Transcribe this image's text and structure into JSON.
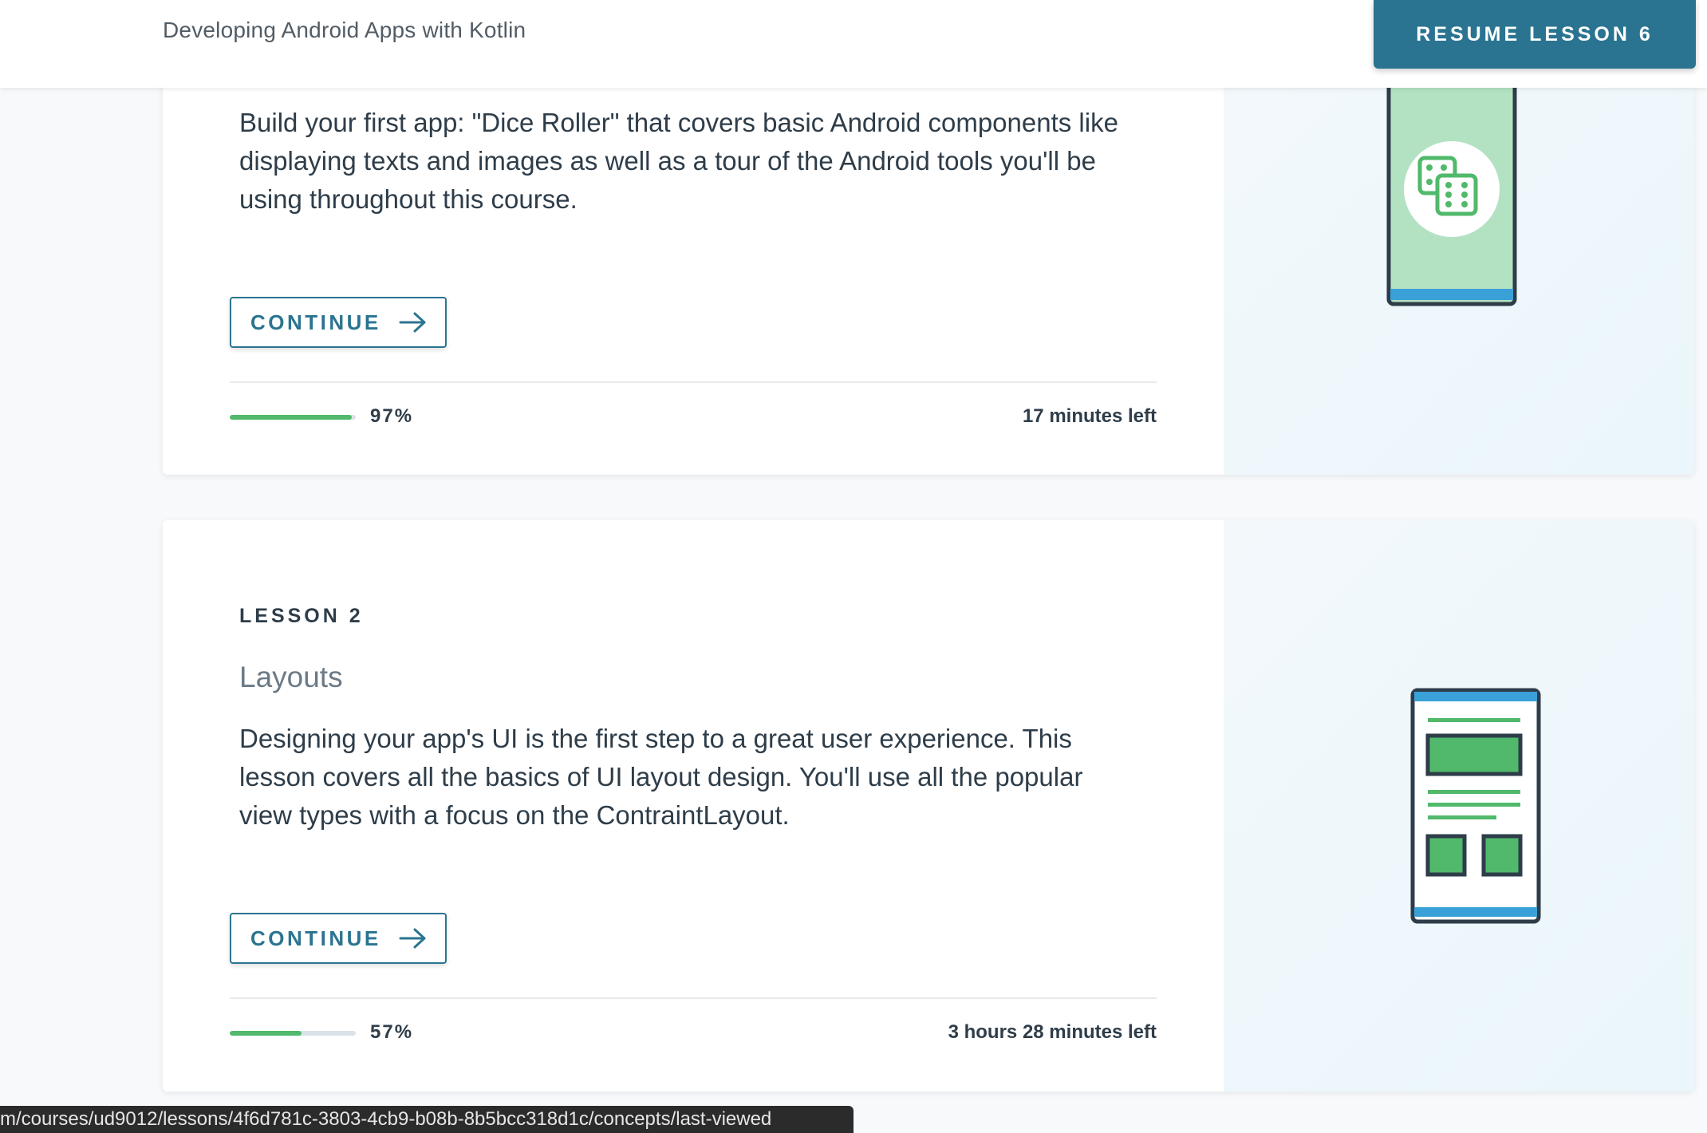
{
  "header": {
    "course_title": "Developing Android Apps with Kotlin",
    "resume_label": "RESUME LESSON 6"
  },
  "lessons": [
    {
      "label": "",
      "name": "",
      "description": "Build your first app: \"Dice Roller\" that covers basic Android components like displaying texts and images as well as a tour of the Android tools you'll be using throughout this course.",
      "continue_label": "CONTINUE",
      "progress_percent": 97,
      "progress_text": "97%",
      "time_left": "17 minutes left",
      "illustration": "dice-phone-icon"
    },
    {
      "label": "LESSON 2",
      "name": "Layouts",
      "description": "Designing your app's UI is the first step to a great user experience. This lesson covers all the basics of UI layout design. You'll use all the popular view types with a focus on the ContraintLayout.",
      "continue_label": "CONTINUE",
      "progress_percent": 57,
      "progress_text": "57%",
      "time_left": "3 hours 28 minutes left",
      "illustration": "layout-phone-icon"
    }
  ],
  "status_bar": {
    "url": "m/courses/ud9012/lessons/4f6d781c-3803-4cb9-b08b-8b5bcc318d1c/concepts/last-viewed"
  },
  "colors": {
    "accent": "#2a7491",
    "progress": "#51b96b",
    "text": "#2e3d49"
  }
}
